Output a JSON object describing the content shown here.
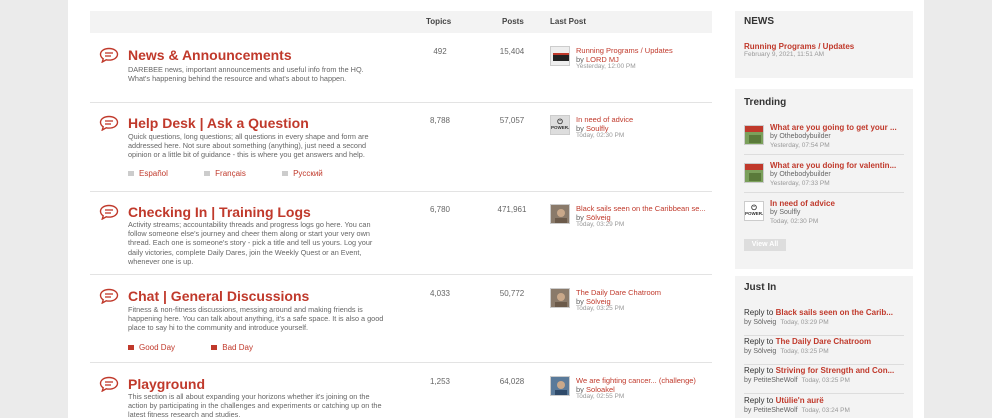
{
  "table_headers": {
    "topics": "Topics",
    "posts": "Posts",
    "last_post": "Last Post"
  },
  "forums": [
    {
      "title": "News & Announcements",
      "desc": "DAREBEE news, important announcements and useful info from the HQ. What's happening behind the resource and what's about to happen.",
      "topics": "492",
      "posts": "15,404",
      "last_title": "Running Programs / Updates",
      "last_by_prefix": "by ",
      "last_user": "LORD MJ",
      "last_date": "Yesterday, 12:00 PM"
    },
    {
      "title": "Help Desk | Ask a Question",
      "desc": "Quick questions, long questions; all questions in every shape and form are addressed here. Not sure about something (anything), just need a second opinion or a little bit of guidance - this is where you get answers and help.",
      "topics": "8,788",
      "posts": "57,057",
      "last_title": "In need of advice",
      "last_by_prefix": "by ",
      "last_user": "Soulfly",
      "last_date": "Today, 02:30 PM",
      "subs": [
        "Español",
        "Français",
        "Русский"
      ]
    },
    {
      "title": "Checking In | Training Logs",
      "desc": "Activity streams; accountability threads and progress logs go here. You can follow someone else's journey and cheer them along or start your very own thread. Each one is someone's story - pick a title and tell us yours. Log your daily victories, complete Daily Dares, join the Weekly Quest or an Event, whenever one is up.",
      "topics": "6,780",
      "posts": "471,961",
      "last_title": "Black sails seen on the Caribbean se...",
      "last_by_prefix": "by ",
      "last_user": "Sölveig",
      "last_date": "Today, 03:29 PM"
    },
    {
      "title": "Chat | General Discussions",
      "desc": "Fitness & non-fitness discussions, messing around and making friends is happening here. You can talk about anything, it's a safe space. It is also a good place to say hi to the community and introduce yourself.",
      "topics": "4,033",
      "posts": "50,772",
      "last_title": "The Daily Dare Chatroom",
      "last_by_prefix": "by ",
      "last_user": "Sölveig",
      "last_date": "Today, 03:25 PM",
      "subs": [
        "Good Day",
        "Bad Day"
      ]
    },
    {
      "title": "Playground",
      "desc": "This section is all about expanding your horizons whether it's joining on the action by participating in the challenges and experiments or catching up on the latest fitness research and studies.",
      "topics": "1,253",
      "posts": "64,028",
      "last_title": "We are fighting cancer... (challenge)",
      "last_by_prefix": "by ",
      "last_user": "Soloakel",
      "last_date": "Today, 02:55 PM"
    }
  ],
  "sidebar": {
    "news": {
      "heading": "NEWS",
      "title": "Running Programs / Updates",
      "date": "February 9, 2021, 11:51 AM"
    },
    "trending": {
      "heading": "Trending",
      "items": [
        {
          "title": "What are you going to get your ...",
          "by": "by Othebodybuilder",
          "date": "Yesterday, 07:54 PM"
        },
        {
          "title": "What are you doing for valentin...",
          "by": "by Othebodybuilder",
          "date": "Yesterday, 07:33 PM"
        },
        {
          "title": "In need of advice",
          "by": "by Soulfly",
          "date": "Today, 02:30 PM"
        }
      ],
      "view_all": "View All"
    },
    "just_in": {
      "heading": "Just In",
      "items": [
        {
          "prefix": "Reply to ",
          "title": "Black sails seen on the Carib...",
          "user": "Sölveig",
          "date": "Today, 03:29 PM"
        },
        {
          "prefix": "Reply to ",
          "title": "The Daily Dare Chatroom",
          "user": "Sölveig",
          "date": "Today, 03:25 PM"
        },
        {
          "prefix": "Reply to ",
          "title": "Striving for Strength and Con...",
          "user": "PetiteSheWolf",
          "date": "Today, 03:25 PM"
        },
        {
          "prefix": "Reply to ",
          "title": "Utülie'n aurë",
          "user": "PetiteSheWolf",
          "date": "Today, 03:24 PM"
        }
      ],
      "by_prefix": "by "
    }
  },
  "power_label": "POWER.",
  "colors": {
    "accent": "#c0392b",
    "panel": "#f3f3f3",
    "background": "#ebebeb"
  }
}
